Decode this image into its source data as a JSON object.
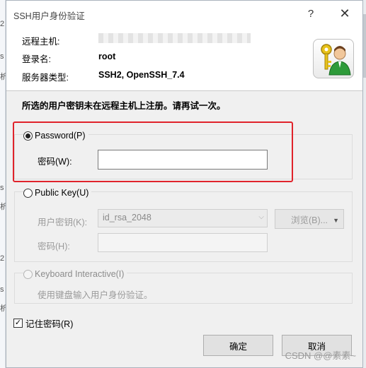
{
  "window": {
    "title": "SSH用户身份验证",
    "help": "?",
    "close": "✕"
  },
  "header": {
    "remote_host_label": "远程主机:",
    "remote_host_value": "",
    "login_label": "登录名:",
    "login_value": "root",
    "server_type_label": "服务器类型:",
    "server_type_value": "SSH2, OpenSSH_7.4"
  },
  "message": "所选的用户密钥未在远程主机上注册。请再试一次。",
  "password_group": {
    "radio_label": "Password(P)",
    "checked": true,
    "field_label": "密码(W):",
    "value": ""
  },
  "publickey_group": {
    "radio_label": "Public Key(U)",
    "key_label": "用户密钥(K):",
    "key_value": "id_rsa_2048",
    "browse_label": "浏览(B)...",
    "passphrase_label": "密码(H):"
  },
  "keyboard_group": {
    "radio_label": "Keyboard Interactive(I)",
    "description": "使用键盘输入用户身份验证。"
  },
  "remember": {
    "label": "记住密码(R)",
    "checked": true,
    "mark": "✓"
  },
  "buttons": {
    "ok": "确定",
    "cancel": "取消"
  },
  "watermark": "CSDN @@素素~",
  "icons": {
    "dialog_icon": "user-key-icon"
  },
  "colors": {
    "highlight": "#e0232b",
    "dialog_bg": "#f0f0f0"
  }
}
